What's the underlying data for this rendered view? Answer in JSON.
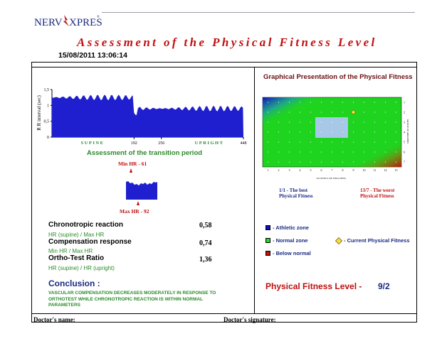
{
  "brand": {
    "left": "NERV",
    "right": "XPRESS",
    "mark": "®"
  },
  "header": {
    "title": "Assessment of the Physical Fitness Level",
    "datetime": "15/08/2011 13:06:14"
  },
  "rr_chart": {
    "ylabel": "R R interval (sec)",
    "yticks": [
      "1,5",
      "1",
      "0,5",
      "0"
    ],
    "xticks": [
      "192",
      "256",
      "448"
    ],
    "phase_labels": [
      "SUPINE",
      "UPRIGHT"
    ],
    "ylim": [
      0,
      1.5
    ],
    "xlim": [
      0,
      448
    ]
  },
  "transition": {
    "title": "Assessment of the transition period",
    "min_hr": "Min HR - 61",
    "max_hr": "Max HR - 92"
  },
  "metrics": [
    {
      "label": "Chronotropic reaction",
      "sub": "HR (supine) / Max HR",
      "value": "0,58"
    },
    {
      "label": "Compensation response",
      "sub": "Min HR / Max HR",
      "value": "0,74"
    },
    {
      "label": "Ortho-Test Ratio",
      "sub": "HR (supine) / HR (upright)",
      "value": "1,36"
    }
  ],
  "conclusion": {
    "title": "Conclusion :",
    "text": "VASCULAR COMPENSATION DECREASES MODERATELY IN RESPONSE TO ORTHOTEST WHILE CHRONOTROPIC REACTION IS WITHIN NORMAL PARAMETERS"
  },
  "fitness": {
    "title": "Graphical Presentation of the Physical Fitness",
    "xaxis_label": "10 LEVELS OF WELLNESS",
    "yaxis_label": "GROUP OF ABILITIES",
    "x_ticks": [
      "1",
      "2",
      "3",
      "4",
      "5",
      "6",
      "7",
      "8",
      "9",
      "10",
      "11",
      "12",
      "13"
    ],
    "y_ticks": [
      "1",
      "2",
      "3",
      "4",
      "5",
      "6",
      "7"
    ],
    "best": {
      "line1": "1/1 - The best",
      "line2": "Physical Fitness",
      "color": "#1a2a80"
    },
    "worst": {
      "line1": "13/7 - The worst",
      "line2": "Physical Fitness",
      "color": "#c01010"
    },
    "legend": [
      {
        "label": "- Athletic zone",
        "color": "#1010c0"
      },
      {
        "label": "- Normal zone",
        "color": "#22dd22"
      },
      {
        "label": "- Below normal",
        "color": "#c01010"
      },
      {
        "label": "- Current Physical Fitness",
        "color": "#f2e040"
      }
    ],
    "level_label": "Physical Fitness Level  -",
    "level_value": "9/2",
    "current_position": {
      "level": 9,
      "group": 2
    }
  },
  "footer": {
    "doctor_name": "Doctor's name:",
    "doctor_signature": "Doctor's signature:"
  },
  "colors": {
    "title_red": "#c01010",
    "green_text": "#2a8a2a",
    "navy": "#1a2a80",
    "map_green": "#1fd41f",
    "highlight": "#a8c8e8"
  }
}
